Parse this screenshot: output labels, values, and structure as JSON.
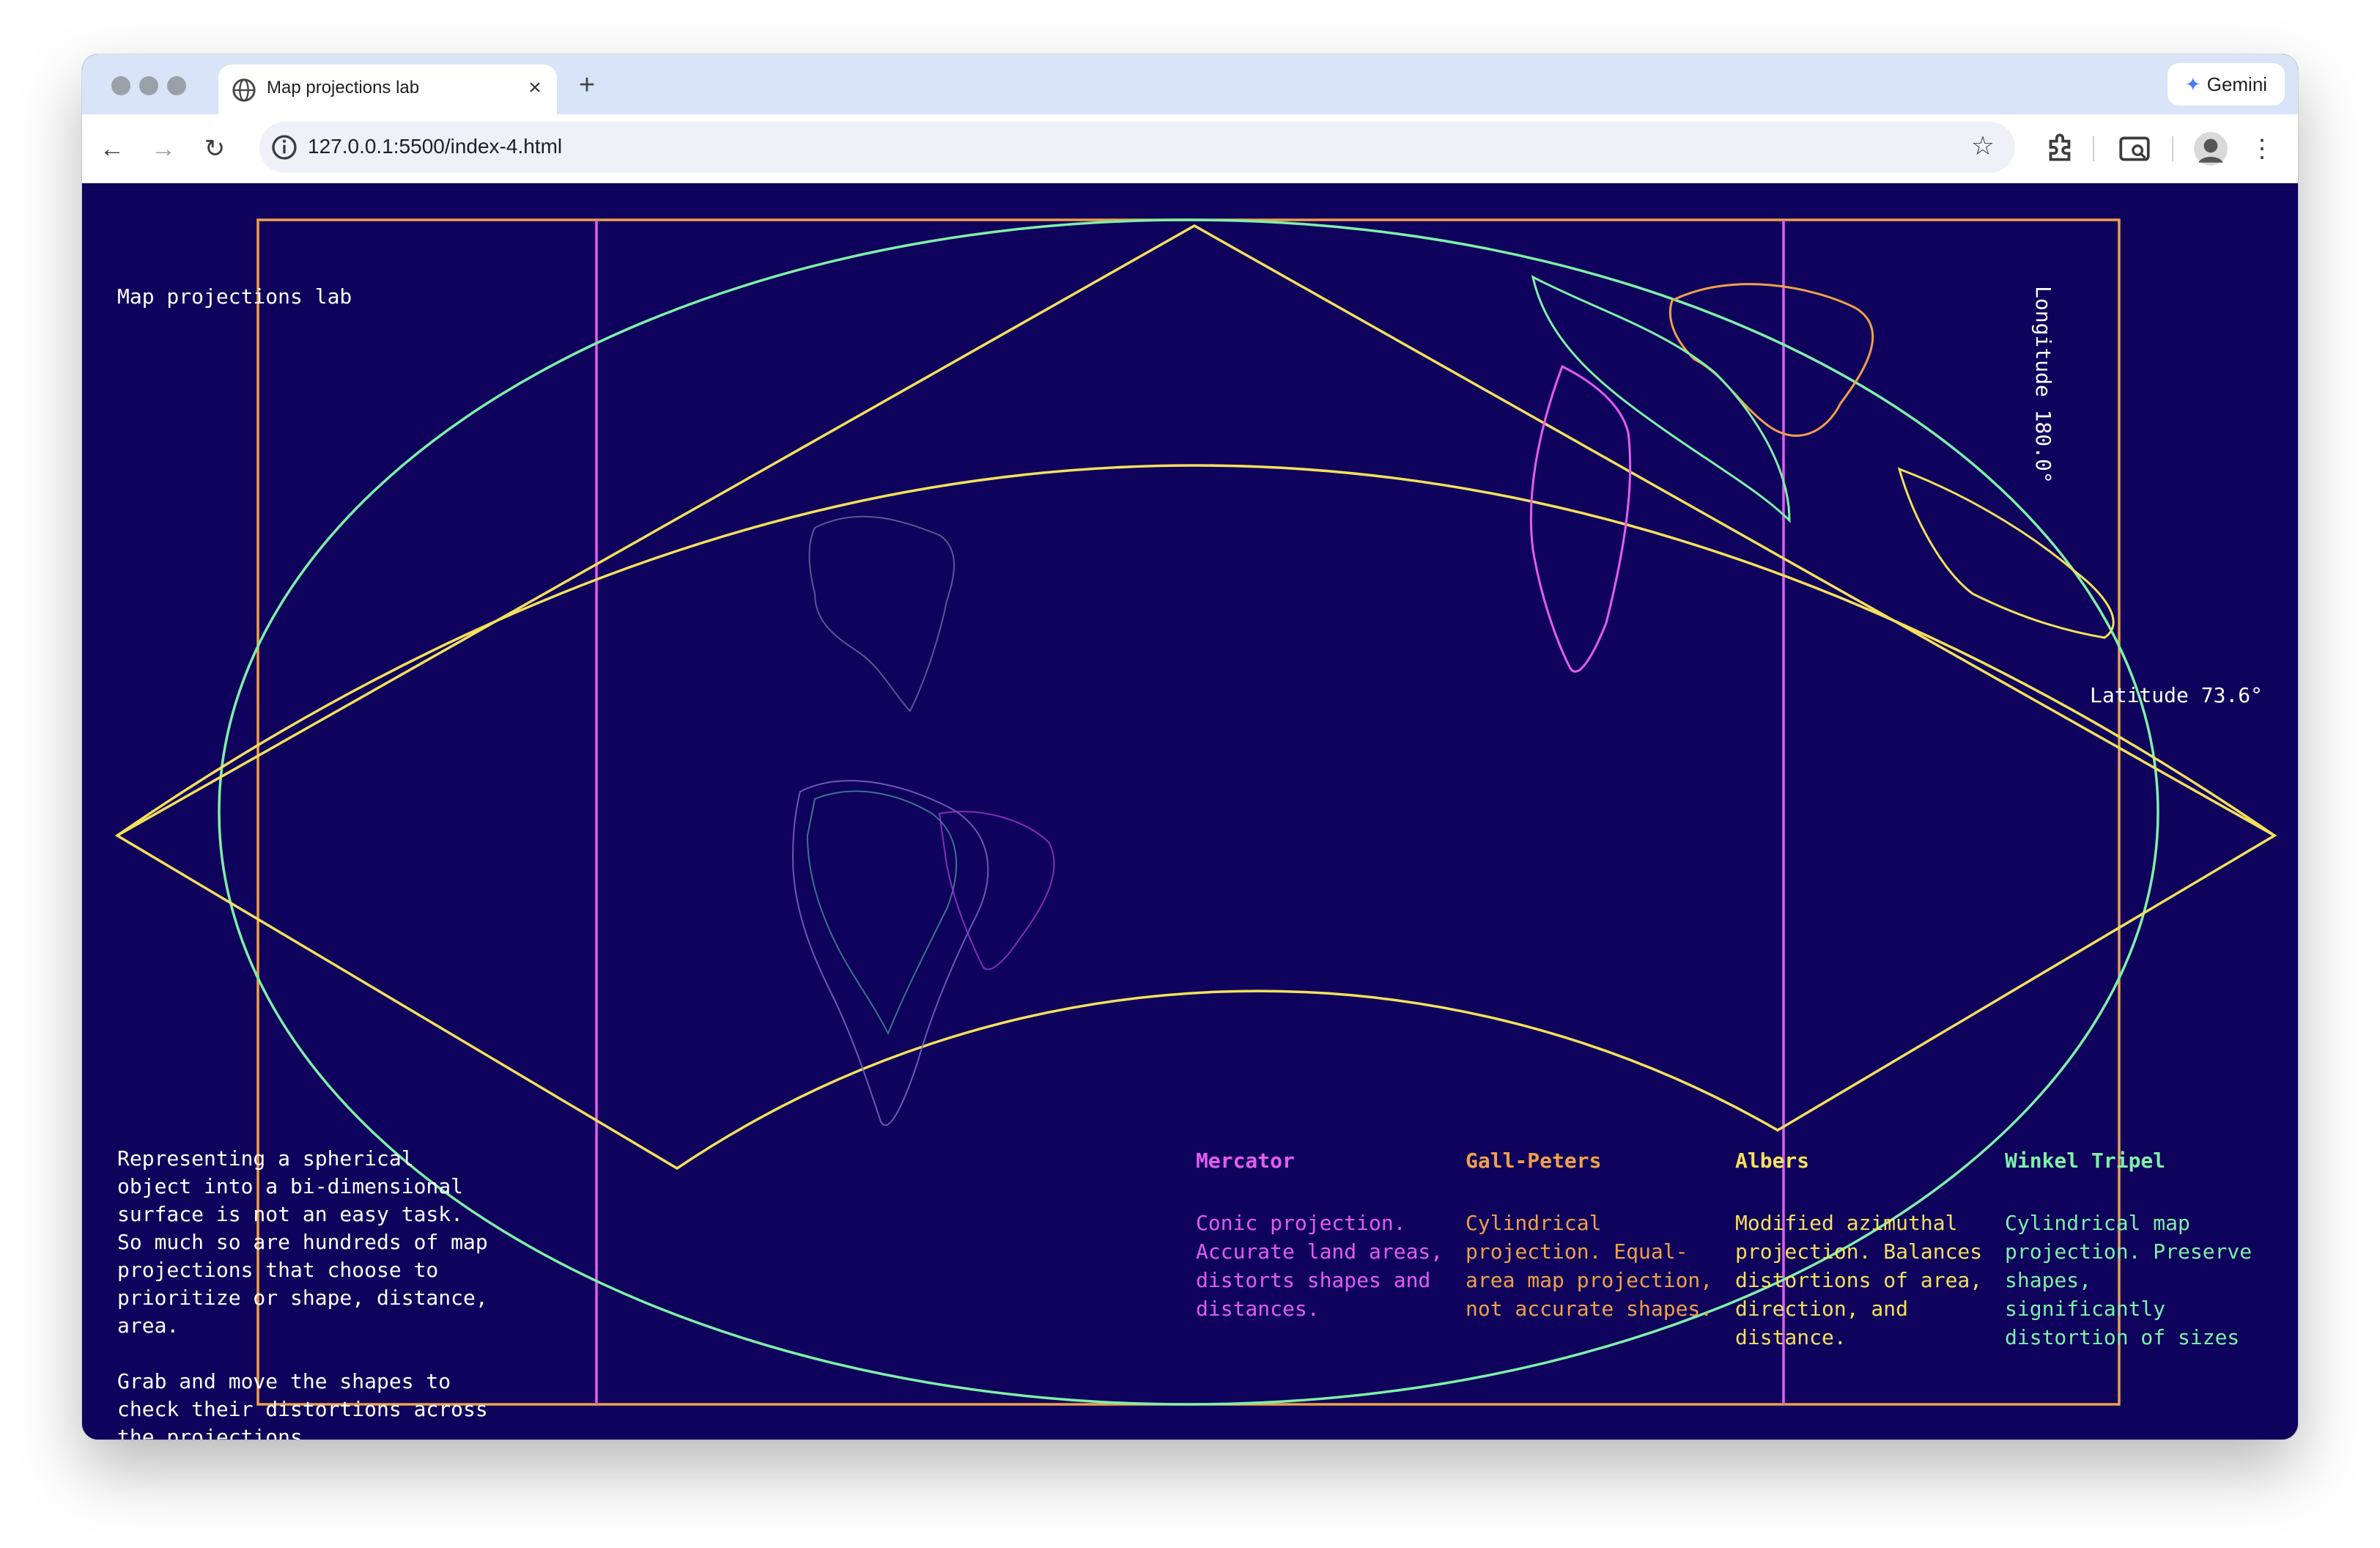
{
  "browser": {
    "tab_title": "Map projections lab",
    "url": "127.0.0.1:5500/index-4.html",
    "gemini_label": "Gemini",
    "new_tab_label": "+",
    "close_tab_label": "×"
  },
  "page": {
    "title": "Map projections lab",
    "longitude_label": "Longitude 180.0°",
    "latitude_label": "Latitude 73.6°",
    "intro": [
      "Representing a spherical object into a bi-dimensional surface is not an easy task. So much so are hundreds of map projections that choose to prioritize or shape, distance, area.",
      "Grab and move the shapes to check their distortions across the projections."
    ]
  },
  "projections": [
    {
      "name": "Mercator",
      "color": "#e45cf0",
      "description": "Conic projection. Accurate land areas, distorts shapes and distances."
    },
    {
      "name": "Gall-Peters",
      "color": "#f0a04a",
      "description": "Cylindrical projection. Equal-area map projection, not accurate shapes."
    },
    {
      "name": "Albers",
      "color": "#f5e05c",
      "description": "Modified azimuthal projection. Balances distortions of area, direction, and distance."
    },
    {
      "name": "Winkel Tripel",
      "color": "#7ef0a8",
      "description": "Cylindrical map projection. Preserve shapes, significantly distortion of sizes"
    }
  ],
  "theme": {
    "background": "#0e025c",
    "text": "#ffffff"
  }
}
